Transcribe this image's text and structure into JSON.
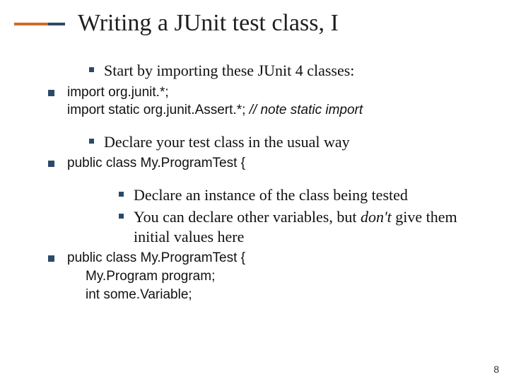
{
  "title": "Writing a JUnit test class, I",
  "s1": {
    "intro": "Start by importing these JUnit 4 classes:",
    "code1": "import org.junit.*;",
    "code2a": "import static org.junit.Assert.*; ",
    "code2b": "// note static import"
  },
  "s2": {
    "intro": "Declare your test class in the usual way",
    "code": "public class My.ProgramTest {"
  },
  "s3": {
    "b1": "Declare an instance of the class being tested",
    "b2a": "You can declare other variables, but ",
    "b2b": "don't",
    "b2c": " give them initial values here",
    "code1": "public class My.ProgramTest {",
    "code2": "My.Program program;",
    "code3": "int some.Variable;"
  },
  "pageNumber": "8"
}
